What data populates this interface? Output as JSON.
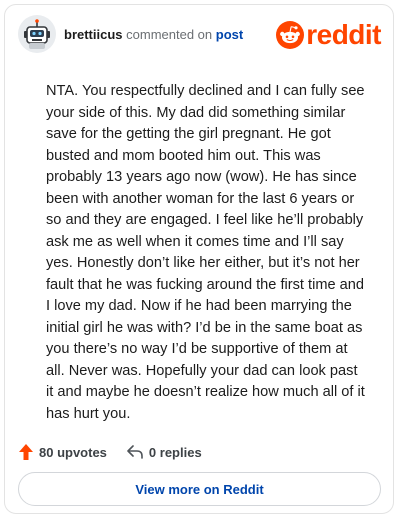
{
  "comment": {
    "author": "brettiicus",
    "action_text": "commented on",
    "target_link": "post",
    "body": "NTA. You respectfully declined and I can fully see your side of this. My dad did something similar save for the getting the girl pregnant. He got busted and mom booted him out. This was probably 13 years ago now (wow). He has since been with another woman for the last 6 years or so and they are engaged. I feel like he’ll probably ask me as well when it comes time and I’ll say yes. Honestly don’t like her either, but it’s not her fault that he was fucking around the first time and I love my dad. Now if he had been marrying the initial girl he was with? I’d be in the same boat as you there’s no way I’d be supportive of them at all. Never was. Hopefully your dad can look past it and maybe he doesn’t realize how much all of it has hurt you."
  },
  "brand": {
    "name": "reddit",
    "icon": "reddit-snoo-icon",
    "color": "#ff4500"
  },
  "stats": {
    "upvotes_label": "80 upvotes",
    "replies_label": "0 replies"
  },
  "footer": {
    "view_more_label": "View more on Reddit"
  },
  "colors": {
    "link": "#0045ac",
    "upvote": "#ff4500",
    "text": "#1c1c1c"
  }
}
